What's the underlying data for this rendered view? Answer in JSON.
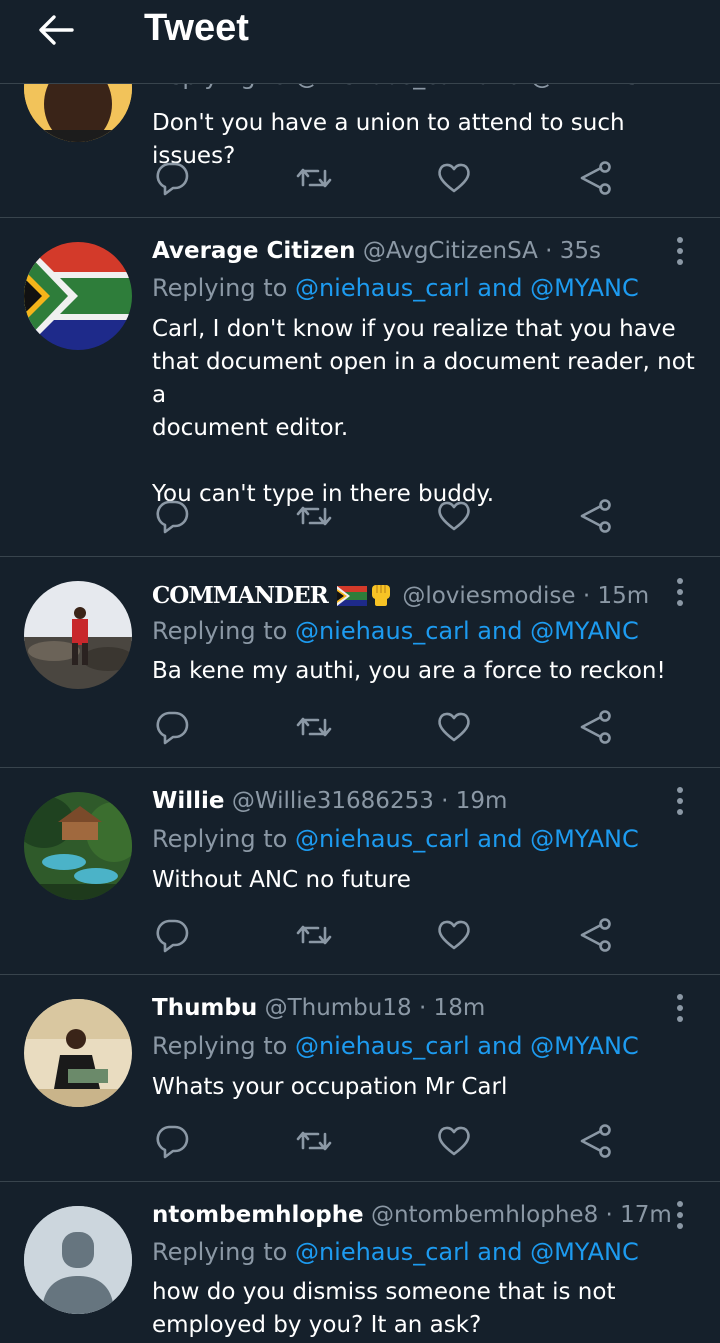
{
  "header": {
    "title": "Tweet"
  },
  "reply_prefix": "Replying to",
  "reply_mentions": "@niehaus_carl and @MYANC",
  "partial_tweet": {
    "reply_line": "Replying to @niehaus_carl and @MYANC",
    "text": "Don't you have a union to attend to such issues?"
  },
  "tweets": [
    {
      "name": "Average Citizen",
      "handle": "@AvgCitizenSA",
      "time": "· 35s",
      "text_lines": [
        "Carl, I don't know if you realize that you have",
        "that document open in a document reader, not a",
        "document editor.",
        "",
        "You can't type in there buddy."
      ]
    },
    {
      "name": "COMMANDER",
      "name_emojis": [
        "south-africa-flag-icon",
        "raised-fist-icon"
      ],
      "handle": "@loviesmodise",
      "time": "· 15m",
      "text_lines": [
        "Ba kene my authi, you are a force to reckon!"
      ]
    },
    {
      "name": "Willie",
      "handle": "@Willie31686253",
      "time": "· 19m",
      "text_lines": [
        "Without ANC no future"
      ]
    },
    {
      "name": "Thumbu",
      "handle": "@Thumbu18",
      "time": "· 18m",
      "text_lines": [
        "Whats your occupation Mr Carl"
      ]
    },
    {
      "name": "ntombemhlophe",
      "handle": "@ntombemhlophe8",
      "time": "· 17m",
      "text_lines": [
        "how do you dismiss someone that is not",
        "employed by you? It an ask?"
      ]
    }
  ],
  "icons": {
    "back": "arrow-left-icon",
    "reply": "comment-icon",
    "retweet": "retweet-icon",
    "like": "heart-icon",
    "share": "share-icon",
    "more": "more-vertical-icon"
  },
  "colors": {
    "background": "#15202b",
    "divider": "#38444d",
    "secondary_text": "#8b98a5",
    "link": "#1d9bf0"
  }
}
